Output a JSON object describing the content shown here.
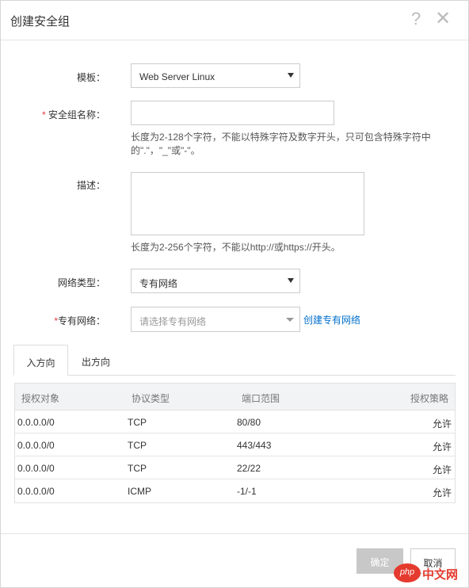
{
  "dialog": {
    "title": "创建安全组",
    "help_icon": "?",
    "close_icon": "✕"
  },
  "form": {
    "template": {
      "label": "模板：",
      "value": "Web Server Linux"
    },
    "name": {
      "required_mark": "*",
      "label": " 安全组名称：",
      "value": "",
      "hint_line1": "长度为2-128个字符，不能以特殊字符及数字开头，只可包含特殊字符中",
      "hint_line2": "的\".\"，\"_\"或\"-\"。"
    },
    "description": {
      "label": "描述：",
      "value": "",
      "hint": "长度为2-256个字符，不能以http://或https://开头。"
    },
    "network_type": {
      "label": "网络类型：",
      "value": "专有网络"
    },
    "vpc": {
      "required_mark": "*",
      "label": "专有网络：",
      "placeholder": "请选择专有网络",
      "create_link": "创建专有网络"
    }
  },
  "tabs": [
    {
      "label": "入方向",
      "active": true
    },
    {
      "label": "出方向",
      "active": false
    }
  ],
  "rules_table": {
    "headers": [
      "授权对象",
      "协议类型",
      "端口范围",
      "授权策略"
    ],
    "rows": [
      [
        "0.0.0.0/0",
        "TCP",
        "80/80",
        "允许"
      ],
      [
        "0.0.0.0/0",
        "TCP",
        "443/443",
        "允许"
      ],
      [
        "0.0.0.0/0",
        "TCP",
        "22/22",
        "允许"
      ],
      [
        "0.0.0.0/0",
        "ICMP",
        "-1/-1",
        "允许"
      ]
    ]
  },
  "footer": {
    "confirm_label": "确定",
    "cancel_label": "取消"
  },
  "watermark": {
    "logo": "php",
    "text": "中文网"
  }
}
